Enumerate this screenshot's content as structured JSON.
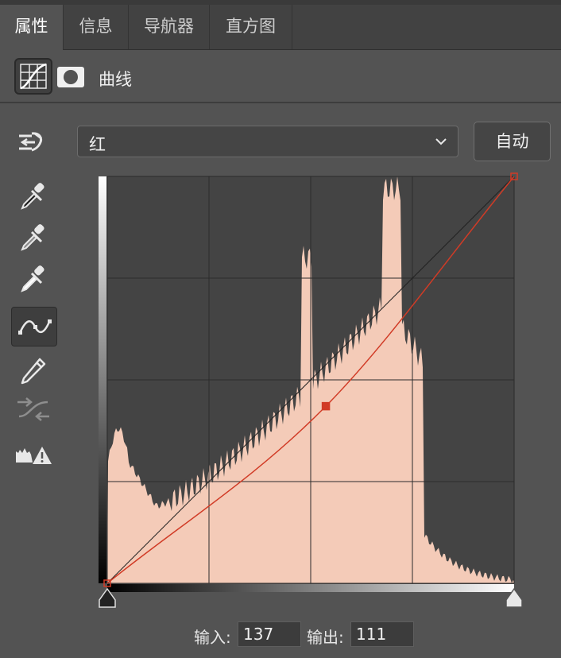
{
  "tabs": [
    {
      "label": "属性",
      "active": true
    },
    {
      "label": "信息",
      "active": false
    },
    {
      "label": "导航器",
      "active": false
    },
    {
      "label": "直方图",
      "active": false
    }
  ],
  "header": {
    "title": "曲线",
    "adjustment_icon": "curves-adjustment-icon",
    "mask_icon": "layer-mask-icon"
  },
  "toolbar": [
    {
      "icon": "target-adjust-icon",
      "active": false
    },
    {
      "icon": "black-point-eyedropper-icon",
      "active": false
    },
    {
      "icon": "gray-point-eyedropper-icon",
      "active": false
    },
    {
      "icon": "white-point-eyedropper-icon",
      "active": false
    },
    {
      "icon": "curve-point-edit-icon",
      "active": true
    },
    {
      "icon": "pencil-draw-icon",
      "active": false
    },
    {
      "icon": "smooth-curve-icon",
      "active": false
    },
    {
      "icon": "clipping-warning-icon",
      "active": false
    }
  ],
  "channel": {
    "selected": "红"
  },
  "auto_button": {
    "label": "自动"
  },
  "curve": {
    "control_points": [
      [
        0,
        0
      ],
      [
        137,
        111
      ],
      [
        255,
        255
      ]
    ],
    "selected_point": [
      137,
      111
    ],
    "color": "#d13b26"
  },
  "histogram_color": "#f4cbb8",
  "io": {
    "input_label": "输入:",
    "input_value": "137",
    "output_label": "输出:",
    "output_value": "111"
  }
}
